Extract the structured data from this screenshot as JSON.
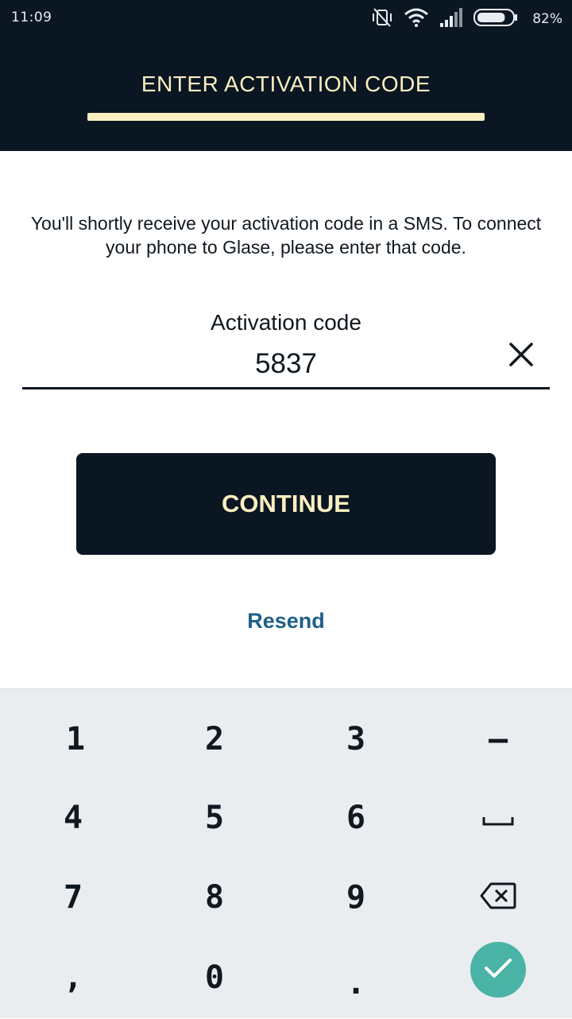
{
  "status_bar": {
    "time": "11:09",
    "battery_percent": "82%",
    "battery_level": 0.82,
    "icons": [
      "vibrate-off-icon",
      "wifi-icon",
      "signal-icon",
      "battery-icon"
    ]
  },
  "header": {
    "title": "ENTER ACTIVATION CODE",
    "progress": 1.0
  },
  "main": {
    "instruction": "You'll shortly receive your activation code in a SMS. To connect your phone to Glase, please enter that code.",
    "field": {
      "label": "Activation code",
      "value": "5837",
      "clear_icon": "close-icon"
    },
    "continue_label": "CONTINUE",
    "resend_label": "Resend"
  },
  "keyboard": {
    "rows": [
      [
        "1",
        "2",
        "3",
        "–"
      ],
      [
        "4",
        "5",
        "6",
        "space-icon"
      ],
      [
        "7",
        "8",
        "9",
        "backspace-icon"
      ],
      [
        ",",
        "0",
        ".",
        "check-icon"
      ]
    ]
  },
  "colors": {
    "dark_navy": "#0b1623",
    "cream_accent": "#fbefc0",
    "link_blue": "#1f5f88",
    "keyboard_bg": "#e9edf0",
    "done_teal": "#49b3a5"
  }
}
